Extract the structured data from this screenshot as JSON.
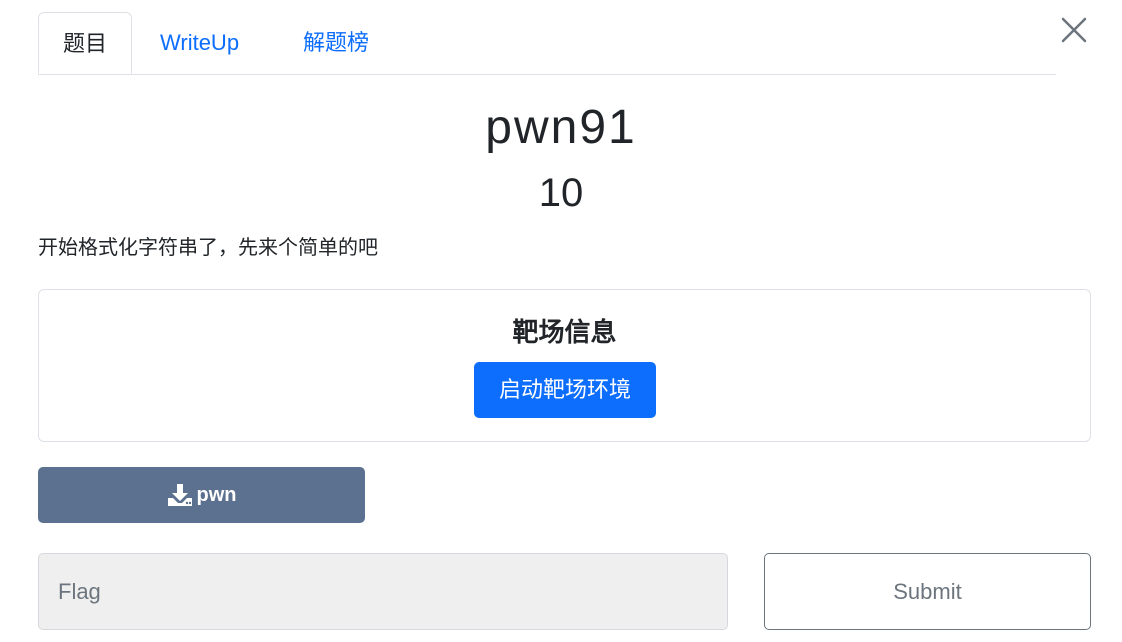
{
  "tabs": [
    {
      "label": "题目",
      "active": true
    },
    {
      "label": "WriteUp",
      "active": false
    },
    {
      "label": "解题榜",
      "active": false
    }
  ],
  "challenge": {
    "name": "pwn91",
    "points": "10",
    "description": "开始格式化字符串了，先来个简单的吧"
  },
  "range_card": {
    "title": "靶场信息",
    "start_button": "启动靶场环境"
  },
  "download": {
    "icon": "download-icon",
    "label": "pwn"
  },
  "flag_form": {
    "placeholder": "Flag",
    "value": "",
    "submit_label": "Submit"
  },
  "colors": {
    "primary": "#0d6efd",
    "download_button": "#5c7190",
    "input_background": "#efefef"
  }
}
